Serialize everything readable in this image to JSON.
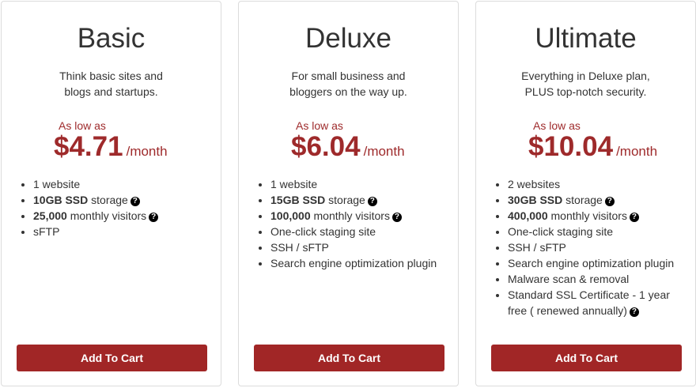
{
  "colors": {
    "accent": "#9e2a2b",
    "button": "#a12626",
    "border": "#dcdcdc",
    "text": "#333333"
  },
  "plans": [
    {
      "name": "Basic",
      "desc1": "Think basic sites and",
      "desc2": "blogs and startups.",
      "as_low_as": "As low as",
      "price": "$4.71",
      "period": "/month",
      "features": [
        {
          "bold": "",
          "text": "1 website",
          "help": false
        },
        {
          "bold": "10GB SSD",
          "text": " storage",
          "help": true
        },
        {
          "bold": "25,000",
          "text": " monthly visitors",
          "help": true
        },
        {
          "bold": "",
          "text": "sFTP",
          "help": false
        }
      ],
      "button": "Add To Cart"
    },
    {
      "name": "Deluxe",
      "desc1": "For small business and",
      "desc2": "bloggers on the way up.",
      "as_low_as": "As low as",
      "price": "$6.04",
      "period": "/month",
      "features": [
        {
          "bold": "",
          "text": "1 website",
          "help": false
        },
        {
          "bold": "15GB SSD",
          "text": " storage",
          "help": true
        },
        {
          "bold": "100,000",
          "text": " monthly visitors",
          "help": true
        },
        {
          "bold": "",
          "text": "One-click staging site",
          "help": false
        },
        {
          "bold": "",
          "text": "SSH / sFTP",
          "help": false
        },
        {
          "bold": "",
          "text": "Search engine optimization plugin",
          "help": false
        }
      ],
      "button": "Add To Cart"
    },
    {
      "name": "Ultimate",
      "desc1": "Everything in Deluxe plan,",
      "desc2": "PLUS top-notch security.",
      "as_low_as": "As low as",
      "price": "$10.04",
      "period": "/month",
      "features": [
        {
          "bold": "",
          "text": "2 websites",
          "help": false
        },
        {
          "bold": "30GB SSD",
          "text": " storage",
          "help": true
        },
        {
          "bold": "400,000",
          "text": " monthly visitors",
          "help": true
        },
        {
          "bold": "",
          "text": "One-click staging site",
          "help": false
        },
        {
          "bold": "",
          "text": "SSH / sFTP",
          "help": false
        },
        {
          "bold": "",
          "text": "Search engine optimization plugin",
          "help": false
        },
        {
          "bold": "",
          "text": "Malware scan & removal",
          "help": false
        },
        {
          "bold": "",
          "text": "Standard SSL Certificate - 1 year free ( renewed annually)",
          "help": true
        }
      ],
      "button": "Add To Cart"
    }
  ]
}
